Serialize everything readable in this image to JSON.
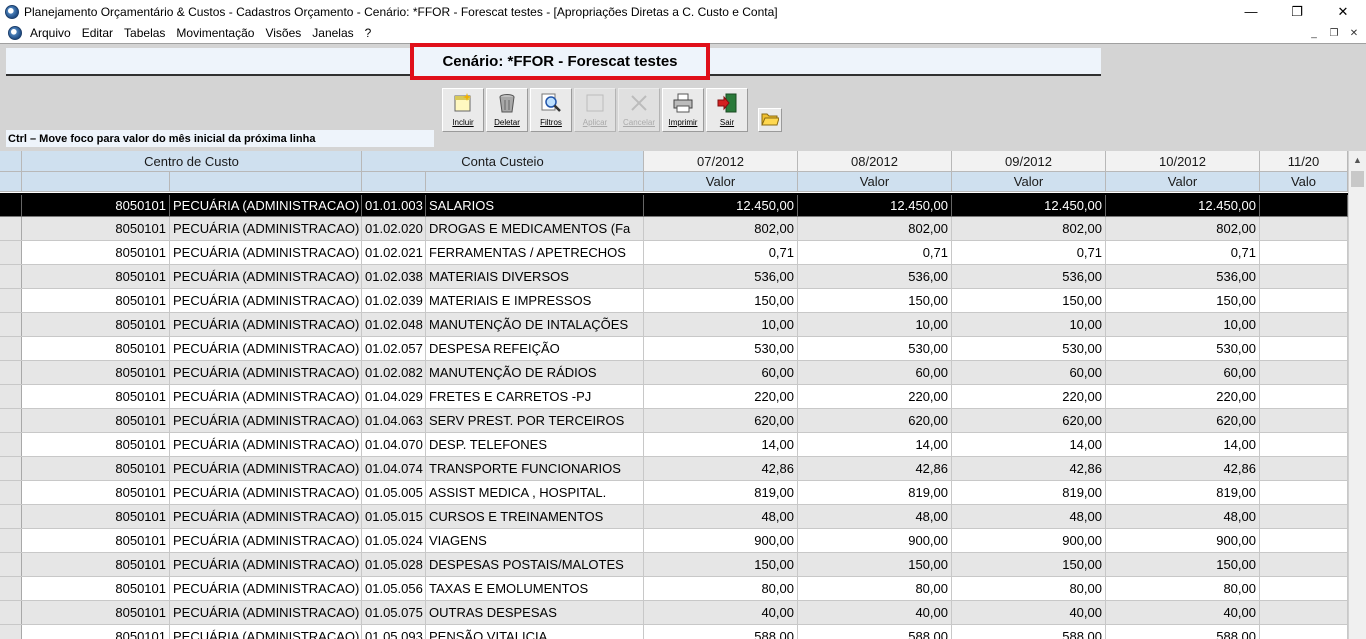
{
  "window": {
    "title": "Planejamento Orçamentário & Custos - Cadastros  Orçamento - Cenário: *FFOR - Forescat testes - [Apropriações Diretas a C. Custo e Conta]",
    "minimize": "—",
    "restore": "❐",
    "close": "✕"
  },
  "menu": {
    "items": [
      "Arquivo",
      "Editar",
      "Tabelas",
      "Movimentação",
      "Visões",
      "Janelas",
      "?"
    ],
    "mdi_min": "_",
    "mdi_restore": "❐",
    "mdi_close": "✕"
  },
  "scenario": {
    "label": "Cenário: *FFOR - Forescat testes"
  },
  "toolbar": {
    "incluir": "Incluir",
    "deletar": "Deletar",
    "filtros": "Filtros",
    "aplicar": "Aplicar",
    "cancelar": "Cancelar",
    "imprimir": "Imprimir",
    "sair": "Sair"
  },
  "hint": "Ctrl – Move foco para valor do mês inicial da próxima linha",
  "grid": {
    "header": {
      "centro_custo": "Centro de Custo",
      "conta_custeio": "Conta Custeio",
      "months": [
        "07/2012",
        "08/2012",
        "09/2012",
        "10/2012",
        "11/20"
      ],
      "valor": [
        "Valor",
        "Valor",
        "Valor",
        "Valor",
        "Valo"
      ]
    },
    "rows": [
      {
        "cc": "8050101",
        "ccn": "PECUÁRIA (ADMINISTRACAO)",
        "ct": "01.01.003",
        "ctn": "SALARIOS",
        "v": "12.450,00"
      },
      {
        "cc": "8050101",
        "ccn": "PECUÁRIA (ADMINISTRACAO)",
        "ct": "01.02.020",
        "ctn": "DROGAS E MEDICAMENTOS (Fa",
        "v": "802,00"
      },
      {
        "cc": "8050101",
        "ccn": "PECUÁRIA (ADMINISTRACAO)",
        "ct": "01.02.021",
        "ctn": "FERRAMENTAS / APETRECHOS",
        "v": "0,71"
      },
      {
        "cc": "8050101",
        "ccn": "PECUÁRIA (ADMINISTRACAO)",
        "ct": "01.02.038",
        "ctn": "MATERIAIS DIVERSOS",
        "v": "536,00"
      },
      {
        "cc": "8050101",
        "ccn": "PECUÁRIA (ADMINISTRACAO)",
        "ct": "01.02.039",
        "ctn": "MATERIAIS E IMPRESSOS",
        "v": "150,00"
      },
      {
        "cc": "8050101",
        "ccn": "PECUÁRIA (ADMINISTRACAO)",
        "ct": "01.02.048",
        "ctn": "MANUTENÇÃO DE INTALAÇÕES",
        "v": "10,00"
      },
      {
        "cc": "8050101",
        "ccn": "PECUÁRIA (ADMINISTRACAO)",
        "ct": "01.02.057",
        "ctn": "DESPESA REFEIÇÃO",
        "v": "530,00"
      },
      {
        "cc": "8050101",
        "ccn": "PECUÁRIA (ADMINISTRACAO)",
        "ct": "01.02.082",
        "ctn": "MANUTENÇÃO DE RÁDIOS",
        "v": "60,00"
      },
      {
        "cc": "8050101",
        "ccn": "PECUÁRIA (ADMINISTRACAO)",
        "ct": "01.04.029",
        "ctn": "FRETES E CARRETOS -PJ",
        "v": "220,00"
      },
      {
        "cc": "8050101",
        "ccn": "PECUÁRIA (ADMINISTRACAO)",
        "ct": "01.04.063",
        "ctn": "SERV PREST. POR TERCEIROS",
        "v": "620,00"
      },
      {
        "cc": "8050101",
        "ccn": "PECUÁRIA (ADMINISTRACAO)",
        "ct": "01.04.070",
        "ctn": "DESP. TELEFONES",
        "v": "14,00"
      },
      {
        "cc": "8050101",
        "ccn": "PECUÁRIA (ADMINISTRACAO)",
        "ct": "01.04.074",
        "ctn": "TRANSPORTE FUNCIONARIOS",
        "v": "42,86"
      },
      {
        "cc": "8050101",
        "ccn": "PECUÁRIA (ADMINISTRACAO)",
        "ct": "01.05.005",
        "ctn": "ASSIST MEDICA , HOSPITAL.",
        "v": "819,00"
      },
      {
        "cc": "8050101",
        "ccn": "PECUÁRIA (ADMINISTRACAO)",
        "ct": "01.05.015",
        "ctn": "CURSOS E TREINAMENTOS",
        "v": "48,00"
      },
      {
        "cc": "8050101",
        "ccn": "PECUÁRIA (ADMINISTRACAO)",
        "ct": "01.05.024",
        "ctn": "VIAGENS",
        "v": "900,00"
      },
      {
        "cc": "8050101",
        "ccn": "PECUÁRIA (ADMINISTRACAO)",
        "ct": "01.05.028",
        "ctn": "DESPESAS POSTAIS/MALOTES",
        "v": "150,00"
      },
      {
        "cc": "8050101",
        "ccn": "PECUÁRIA (ADMINISTRACAO)",
        "ct": "01.05.056",
        "ctn": "TAXAS E EMOLUMENTOS",
        "v": "80,00"
      },
      {
        "cc": "8050101",
        "ccn": "PECUÁRIA (ADMINISTRACAO)",
        "ct": "01.05.075",
        "ctn": "OUTRAS DESPESAS",
        "v": "40,00"
      },
      {
        "cc": "8050101",
        "ccn": "PECUÁRIA (ADMINISTRACAO)",
        "ct": "01.05.093",
        "ctn": "PENSÃO VITALICIA",
        "v": "588,00"
      }
    ]
  },
  "colors": {
    "highlight_border": "#e0101a",
    "selected_row": "#000000",
    "header_blue": "#cfe0ef"
  }
}
